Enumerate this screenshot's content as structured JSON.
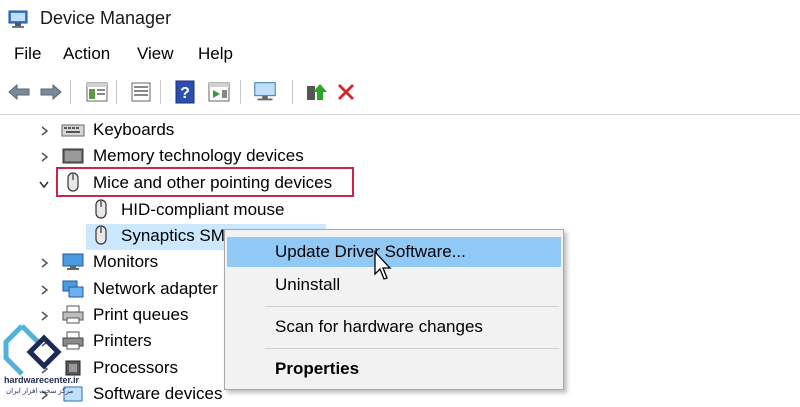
{
  "window": {
    "title": "Device Manager"
  },
  "menu": [
    "File",
    "Action",
    "View",
    "Help"
  ],
  "toolbar": {
    "buttons": [
      "back-icon",
      "forward-icon",
      "properties-icon",
      "list-icon",
      "help-icon",
      "action-pane-icon",
      "monitor-scan-icon",
      "update-driver-icon",
      "uninstall-icon"
    ],
    "uninstall_color": "#d8242b"
  },
  "tree": {
    "items": [
      {
        "label": "Keyboards",
        "expanded": false
      },
      {
        "label": "Memory technology devices",
        "expanded": false
      },
      {
        "label": "Mice and other pointing devices",
        "expanded": true
      },
      {
        "label": "HID-compliant mouse",
        "child": true
      },
      {
        "label": "Synaptics SMBus ClickPad",
        "child": true,
        "selected": true
      },
      {
        "label": "Monitors",
        "expanded": false
      },
      {
        "label": "Network adapters",
        "expanded": false
      },
      {
        "label": "Print queues",
        "expanded": false
      },
      {
        "label": "Printers",
        "expanded": false
      },
      {
        "label": "Processors",
        "expanded": false
      },
      {
        "label": "Software devices",
        "expanded": false
      }
    ],
    "selected_visible_label": "Synaptics SMB",
    "network_visible_label": "Network adapter"
  },
  "context_menu": {
    "items": [
      {
        "label": "Update Driver Software...",
        "highlighted": true
      },
      {
        "label": "Uninstall"
      },
      {
        "label": "Scan for hardware changes"
      },
      {
        "label": "Properties",
        "bold": true
      }
    ]
  },
  "colors": {
    "highlight_box": "#c8264a",
    "selection": "#cce8ff",
    "menu_hover": "#90c8f6"
  },
  "watermark": {
    "line1": "hardwarecenter.ir",
    "line2": "مرکز سخت افزار ایران"
  }
}
